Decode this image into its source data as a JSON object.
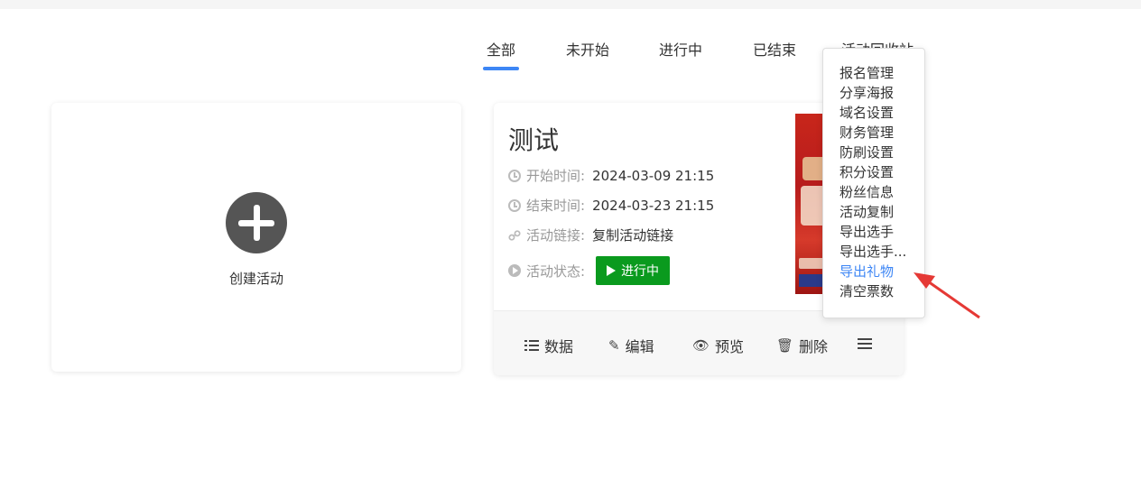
{
  "tabs": {
    "items": [
      {
        "label": "全部",
        "active": true
      },
      {
        "label": "未开始"
      },
      {
        "label": "进行中"
      },
      {
        "label": "已结束"
      },
      {
        "label": "活动回收站"
      }
    ]
  },
  "create_card": {
    "label": "创建活动"
  },
  "activity": {
    "title": "测试",
    "start_label": "开始时间:",
    "start_value": "2024-03-09 21:15",
    "end_label": "结束时间:",
    "end_value": "2024-03-23 21:15",
    "link_label": "活动链接:",
    "link_value": "复制活动链接",
    "status_label": "活动状态:",
    "status_value": "进行中",
    "status_color": "#0a9a1e"
  },
  "footer": {
    "data_label": "数据",
    "edit_label": "编辑",
    "preview_label": "预览",
    "delete_label": "删除"
  },
  "dropdown": {
    "items": [
      {
        "label": "报名管理"
      },
      {
        "label": "分享海报"
      },
      {
        "label": "域名设置"
      },
      {
        "label": "财务管理"
      },
      {
        "label": "防刷设置"
      },
      {
        "label": "积分设置"
      },
      {
        "label": "粉丝信息"
      },
      {
        "label": "活动复制"
      },
      {
        "label": "导出选手"
      },
      {
        "label": "导出选手..."
      },
      {
        "label": "导出礼物",
        "highlighted": true
      },
      {
        "label": "清空票数"
      }
    ],
    "highlight_color": "#3d86f5"
  },
  "accent_color": "#3d86f5",
  "annotation_arrow_color": "#e53935"
}
